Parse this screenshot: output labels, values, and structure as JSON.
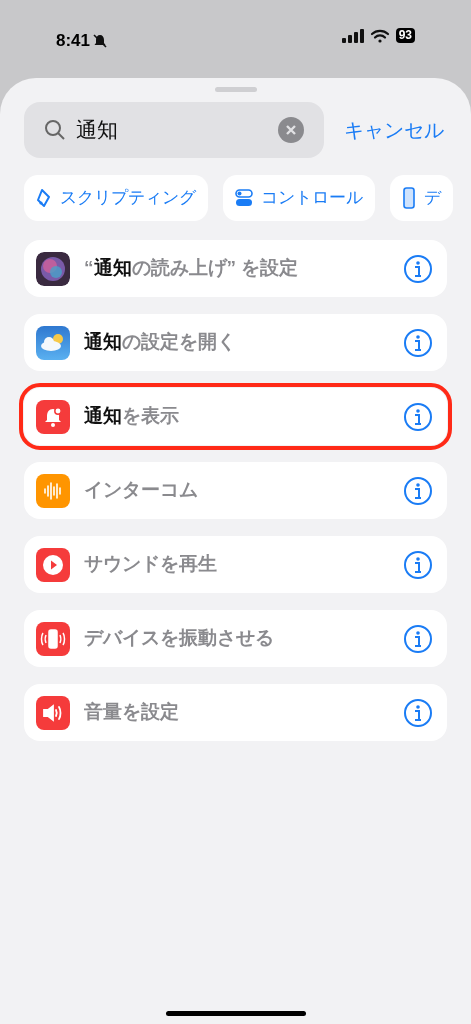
{
  "status_bar": {
    "time": "8:41",
    "battery": "93"
  },
  "search": {
    "value": "通知",
    "cancel": "キャンセル"
  },
  "chips": [
    {
      "label": "スクリプティング"
    },
    {
      "label": "コントロール"
    },
    {
      "label": "デ"
    }
  ],
  "results": [
    {
      "label": "“**通知**の読み上げ” を設定",
      "highlighted": false
    },
    {
      "label": "**通知**の設定を開く",
      "highlighted": false
    },
    {
      "label": "**通知**を表示",
      "highlighted": true
    },
    {
      "label": "インターコム",
      "highlighted": false
    },
    {
      "label": "サウンドを再生",
      "highlighted": false
    },
    {
      "label": "デバイスを振動させる",
      "highlighted": false
    },
    {
      "label": "音量を設定",
      "highlighted": false
    }
  ]
}
